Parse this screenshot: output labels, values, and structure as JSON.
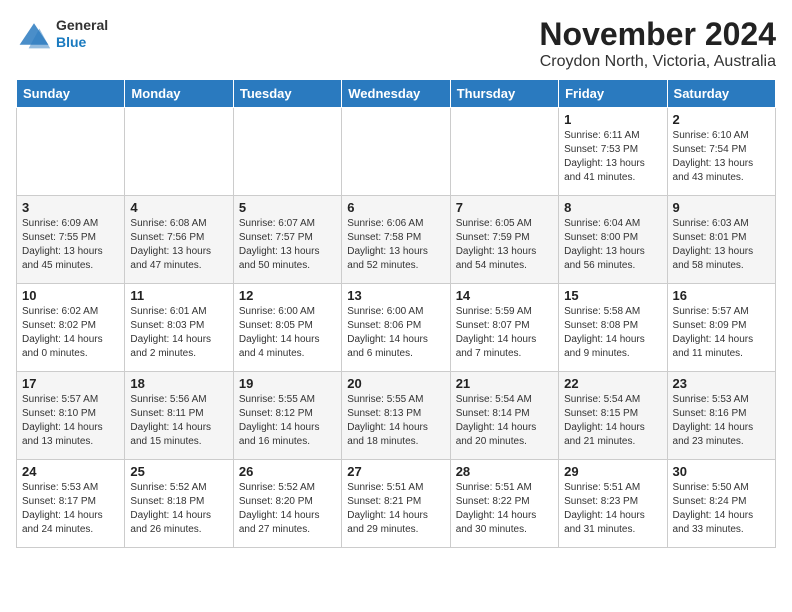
{
  "logo": {
    "general": "General",
    "blue": "Blue"
  },
  "header": {
    "month": "November 2024",
    "location": "Croydon North, Victoria, Australia"
  },
  "weekdays": [
    "Sunday",
    "Monday",
    "Tuesday",
    "Wednesday",
    "Thursday",
    "Friday",
    "Saturday"
  ],
  "weeks": [
    [
      {
        "day": "",
        "info": ""
      },
      {
        "day": "",
        "info": ""
      },
      {
        "day": "",
        "info": ""
      },
      {
        "day": "",
        "info": ""
      },
      {
        "day": "",
        "info": ""
      },
      {
        "day": "1",
        "info": "Sunrise: 6:11 AM\nSunset: 7:53 PM\nDaylight: 13 hours\nand 41 minutes."
      },
      {
        "day": "2",
        "info": "Sunrise: 6:10 AM\nSunset: 7:54 PM\nDaylight: 13 hours\nand 43 minutes."
      }
    ],
    [
      {
        "day": "3",
        "info": "Sunrise: 6:09 AM\nSunset: 7:55 PM\nDaylight: 13 hours\nand 45 minutes."
      },
      {
        "day": "4",
        "info": "Sunrise: 6:08 AM\nSunset: 7:56 PM\nDaylight: 13 hours\nand 47 minutes."
      },
      {
        "day": "5",
        "info": "Sunrise: 6:07 AM\nSunset: 7:57 PM\nDaylight: 13 hours\nand 50 minutes."
      },
      {
        "day": "6",
        "info": "Sunrise: 6:06 AM\nSunset: 7:58 PM\nDaylight: 13 hours\nand 52 minutes."
      },
      {
        "day": "7",
        "info": "Sunrise: 6:05 AM\nSunset: 7:59 PM\nDaylight: 13 hours\nand 54 minutes."
      },
      {
        "day": "8",
        "info": "Sunrise: 6:04 AM\nSunset: 8:00 PM\nDaylight: 13 hours\nand 56 minutes."
      },
      {
        "day": "9",
        "info": "Sunrise: 6:03 AM\nSunset: 8:01 PM\nDaylight: 13 hours\nand 58 minutes."
      }
    ],
    [
      {
        "day": "10",
        "info": "Sunrise: 6:02 AM\nSunset: 8:02 PM\nDaylight: 14 hours\nand 0 minutes."
      },
      {
        "day": "11",
        "info": "Sunrise: 6:01 AM\nSunset: 8:03 PM\nDaylight: 14 hours\nand 2 minutes."
      },
      {
        "day": "12",
        "info": "Sunrise: 6:00 AM\nSunset: 8:05 PM\nDaylight: 14 hours\nand 4 minutes."
      },
      {
        "day": "13",
        "info": "Sunrise: 6:00 AM\nSunset: 8:06 PM\nDaylight: 14 hours\nand 6 minutes."
      },
      {
        "day": "14",
        "info": "Sunrise: 5:59 AM\nSunset: 8:07 PM\nDaylight: 14 hours\nand 7 minutes."
      },
      {
        "day": "15",
        "info": "Sunrise: 5:58 AM\nSunset: 8:08 PM\nDaylight: 14 hours\nand 9 minutes."
      },
      {
        "day": "16",
        "info": "Sunrise: 5:57 AM\nSunset: 8:09 PM\nDaylight: 14 hours\nand 11 minutes."
      }
    ],
    [
      {
        "day": "17",
        "info": "Sunrise: 5:57 AM\nSunset: 8:10 PM\nDaylight: 14 hours\nand 13 minutes."
      },
      {
        "day": "18",
        "info": "Sunrise: 5:56 AM\nSunset: 8:11 PM\nDaylight: 14 hours\nand 15 minutes."
      },
      {
        "day": "19",
        "info": "Sunrise: 5:55 AM\nSunset: 8:12 PM\nDaylight: 14 hours\nand 16 minutes."
      },
      {
        "day": "20",
        "info": "Sunrise: 5:55 AM\nSunset: 8:13 PM\nDaylight: 14 hours\nand 18 minutes."
      },
      {
        "day": "21",
        "info": "Sunrise: 5:54 AM\nSunset: 8:14 PM\nDaylight: 14 hours\nand 20 minutes."
      },
      {
        "day": "22",
        "info": "Sunrise: 5:54 AM\nSunset: 8:15 PM\nDaylight: 14 hours\nand 21 minutes."
      },
      {
        "day": "23",
        "info": "Sunrise: 5:53 AM\nSunset: 8:16 PM\nDaylight: 14 hours\nand 23 minutes."
      }
    ],
    [
      {
        "day": "24",
        "info": "Sunrise: 5:53 AM\nSunset: 8:17 PM\nDaylight: 14 hours\nand 24 minutes."
      },
      {
        "day": "25",
        "info": "Sunrise: 5:52 AM\nSunset: 8:18 PM\nDaylight: 14 hours\nand 26 minutes."
      },
      {
        "day": "26",
        "info": "Sunrise: 5:52 AM\nSunset: 8:20 PM\nDaylight: 14 hours\nand 27 minutes."
      },
      {
        "day": "27",
        "info": "Sunrise: 5:51 AM\nSunset: 8:21 PM\nDaylight: 14 hours\nand 29 minutes."
      },
      {
        "day": "28",
        "info": "Sunrise: 5:51 AM\nSunset: 8:22 PM\nDaylight: 14 hours\nand 30 minutes."
      },
      {
        "day": "29",
        "info": "Sunrise: 5:51 AM\nSunset: 8:23 PM\nDaylight: 14 hours\nand 31 minutes."
      },
      {
        "day": "30",
        "info": "Sunrise: 5:50 AM\nSunset: 8:24 PM\nDaylight: 14 hours\nand 33 minutes."
      }
    ]
  ]
}
